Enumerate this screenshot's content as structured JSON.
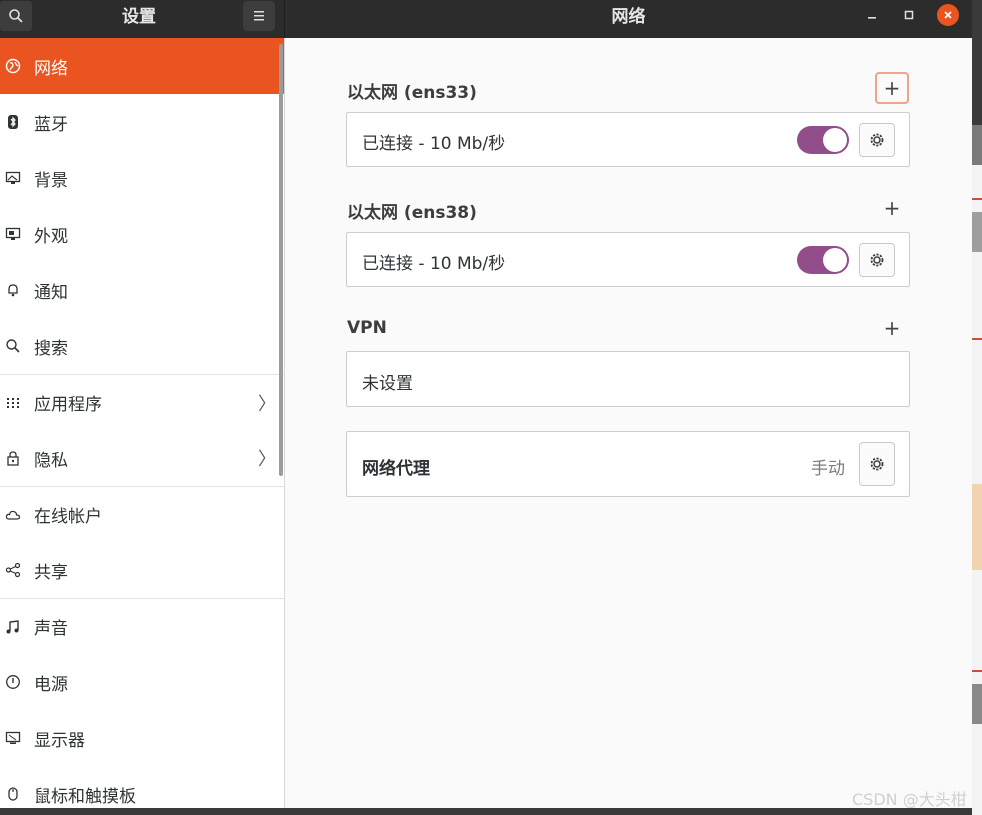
{
  "header": {
    "sidebar_title": "设置",
    "main_title": "网络",
    "search_icon": "search-icon",
    "menu_icon": "hamburger-menu-icon"
  },
  "sidebar": {
    "items": [
      {
        "label": "网络",
        "icon": "network-icon",
        "active": true
      },
      {
        "label": "蓝牙",
        "icon": "bluetooth-icon"
      },
      {
        "label": "背景",
        "icon": "background-icon"
      },
      {
        "label": "外观",
        "icon": "appearance-icon"
      },
      {
        "label": "通知",
        "icon": "bell-icon"
      },
      {
        "label": "搜索",
        "icon": "search-icon"
      },
      {
        "label": "应用程序",
        "icon": "apps-grid-icon",
        "chevron": "〉"
      },
      {
        "label": "隐私",
        "icon": "lock-icon",
        "chevron": "〉"
      },
      {
        "label": "在线帐户",
        "icon": "cloud-icon"
      },
      {
        "label": "共享",
        "icon": "share-icon"
      },
      {
        "label": "声音",
        "icon": "music-note-icon"
      },
      {
        "label": "电源",
        "icon": "power-icon"
      },
      {
        "label": "显示器",
        "icon": "display-icon"
      },
      {
        "label": "鼠标和触摸板",
        "icon": "mouse-icon"
      }
    ]
  },
  "main": {
    "sections": [
      {
        "title": "以太网 (ens33)",
        "status": "已连接 - 10 Mb/秒",
        "toggle_on": true
      },
      {
        "title": "以太网 (ens38)",
        "status": "已连接 - 10 Mb/秒",
        "toggle_on": true
      },
      {
        "title": "VPN",
        "status": "未设置"
      }
    ],
    "proxy": {
      "label": "网络代理",
      "mode": "手动"
    }
  },
  "watermark": "CSDN @大头柑",
  "colors": {
    "accent": "#e95420",
    "toggle": "#924d8b",
    "header": "#2c2c2c"
  }
}
